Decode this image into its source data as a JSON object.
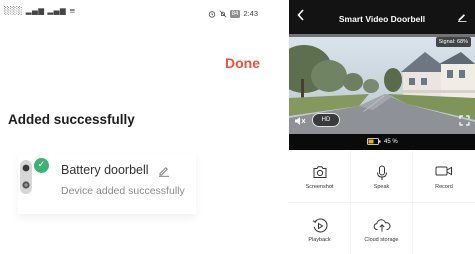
{
  "left": {
    "status_bar": {
      "left_icons": "░░░ ▂▄▆ ▂▄▆ ≡",
      "battery": "84",
      "time": "2:43"
    },
    "done_label": "Done",
    "title": "Added successfully",
    "device": {
      "name": "Battery doorbell",
      "status": "Device added successfully",
      "check_icon": "✓"
    }
  },
  "right": {
    "title": "Smart Video Doorbell",
    "signal": "Signal: 68%",
    "hd_label": "HD",
    "battery_level": "45 %",
    "actions": [
      {
        "label": "Screenshot",
        "icon": "camera-icon"
      },
      {
        "label": "Speak",
        "icon": "microphone-icon"
      },
      {
        "label": "Record",
        "icon": "video-camera-icon"
      },
      {
        "label": "Playback",
        "icon": "playback-icon"
      },
      {
        "label": "Cloud storage",
        "icon": "cloud-upload-icon"
      },
      {
        "label": "",
        "icon": ""
      }
    ]
  },
  "colors": {
    "accent": "#e8533c",
    "success": "#3cb371",
    "battery_fill": "#f5a623",
    "header_bg": "#131313"
  }
}
